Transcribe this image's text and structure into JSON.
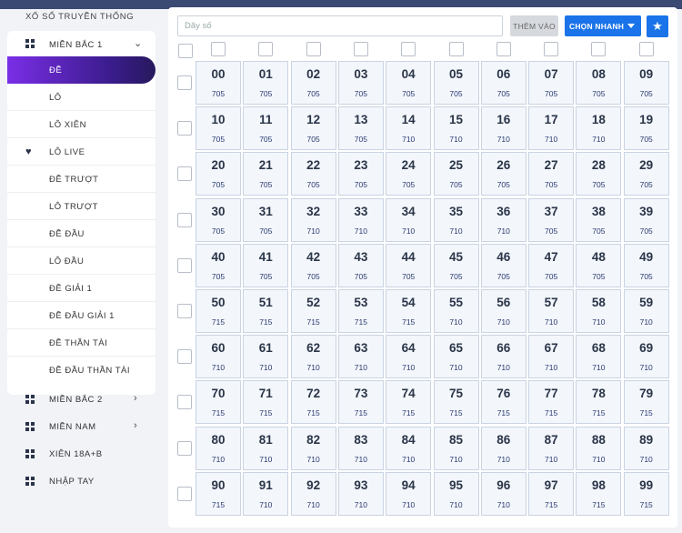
{
  "sidebar": {
    "title": "XỔ SỐ TRUYỀN THỐNG",
    "group": {
      "label": "MIỀN BẮC 1",
      "items": [
        {
          "label": "ĐỀ",
          "active": true
        },
        {
          "label": "LÔ"
        },
        {
          "label": "LÔ XIÊN"
        },
        {
          "label": "LÔ LIVE",
          "icon": "heart-icon"
        },
        {
          "label": "ĐỀ TRƯỢT"
        },
        {
          "label": "LÔ TRƯỢT"
        },
        {
          "label": "ĐỀ ĐẦU"
        },
        {
          "label": "LÔ ĐẦU"
        },
        {
          "label": "ĐỀ GIẢI 1"
        },
        {
          "label": "ĐỀ ĐẦU GIẢI 1"
        },
        {
          "label": "ĐỀ THẦN TÀI"
        },
        {
          "label": "ĐỀ ĐẦU THẦN TÀI"
        }
      ]
    },
    "others": [
      {
        "label": "MIỀN BẮC 2",
        "chevron": true
      },
      {
        "label": "MIỀN NAM",
        "chevron": true
      },
      {
        "label": "XIÊN 18A+B",
        "chevron": false
      },
      {
        "label": "NHẬP TAY",
        "chevron": false
      }
    ]
  },
  "toolbar": {
    "search_placeholder": "Dãy số",
    "add_label": "THÊM VÀO",
    "quick_label": "CHỌN NHANH"
  },
  "numbers": [
    {
      "n": "00",
      "c": "705"
    },
    {
      "n": "01",
      "c": "705"
    },
    {
      "n": "02",
      "c": "705"
    },
    {
      "n": "03",
      "c": "705"
    },
    {
      "n": "04",
      "c": "705"
    },
    {
      "n": "05",
      "c": "705"
    },
    {
      "n": "06",
      "c": "705"
    },
    {
      "n": "07",
      "c": "705"
    },
    {
      "n": "08",
      "c": "705"
    },
    {
      "n": "09",
      "c": "705"
    },
    {
      "n": "10",
      "c": "705"
    },
    {
      "n": "11",
      "c": "705"
    },
    {
      "n": "12",
      "c": "705"
    },
    {
      "n": "13",
      "c": "705"
    },
    {
      "n": "14",
      "c": "710"
    },
    {
      "n": "15",
      "c": "710"
    },
    {
      "n": "16",
      "c": "710"
    },
    {
      "n": "17",
      "c": "710"
    },
    {
      "n": "18",
      "c": "710"
    },
    {
      "n": "19",
      "c": "705"
    },
    {
      "n": "20",
      "c": "705"
    },
    {
      "n": "21",
      "c": "705"
    },
    {
      "n": "22",
      "c": "705"
    },
    {
      "n": "23",
      "c": "705"
    },
    {
      "n": "24",
      "c": "705"
    },
    {
      "n": "25",
      "c": "705"
    },
    {
      "n": "26",
      "c": "705"
    },
    {
      "n": "27",
      "c": "705"
    },
    {
      "n": "28",
      "c": "705"
    },
    {
      "n": "29",
      "c": "705"
    },
    {
      "n": "30",
      "c": "705"
    },
    {
      "n": "31",
      "c": "705"
    },
    {
      "n": "32",
      "c": "710"
    },
    {
      "n": "33",
      "c": "710"
    },
    {
      "n": "34",
      "c": "710"
    },
    {
      "n": "35",
      "c": "710"
    },
    {
      "n": "36",
      "c": "710"
    },
    {
      "n": "37",
      "c": "705"
    },
    {
      "n": "38",
      "c": "705"
    },
    {
      "n": "39",
      "c": "705"
    },
    {
      "n": "40",
      "c": "705"
    },
    {
      "n": "41",
      "c": "705"
    },
    {
      "n": "42",
      "c": "705"
    },
    {
      "n": "43",
      "c": "705"
    },
    {
      "n": "44",
      "c": "705"
    },
    {
      "n": "45",
      "c": "705"
    },
    {
      "n": "46",
      "c": "705"
    },
    {
      "n": "47",
      "c": "705"
    },
    {
      "n": "48",
      "c": "705"
    },
    {
      "n": "49",
      "c": "705"
    },
    {
      "n": "50",
      "c": "715"
    },
    {
      "n": "51",
      "c": "715"
    },
    {
      "n": "52",
      "c": "715"
    },
    {
      "n": "53",
      "c": "715"
    },
    {
      "n": "54",
      "c": "715"
    },
    {
      "n": "55",
      "c": "710"
    },
    {
      "n": "56",
      "c": "710"
    },
    {
      "n": "57",
      "c": "710"
    },
    {
      "n": "58",
      "c": "710"
    },
    {
      "n": "59",
      "c": "710"
    },
    {
      "n": "60",
      "c": "710"
    },
    {
      "n": "61",
      "c": "710"
    },
    {
      "n": "62",
      "c": "710"
    },
    {
      "n": "63",
      "c": "710"
    },
    {
      "n": "64",
      "c": "710"
    },
    {
      "n": "65",
      "c": "710"
    },
    {
      "n": "66",
      "c": "710"
    },
    {
      "n": "67",
      "c": "710"
    },
    {
      "n": "68",
      "c": "710"
    },
    {
      "n": "69",
      "c": "710"
    },
    {
      "n": "70",
      "c": "715"
    },
    {
      "n": "71",
      "c": "715"
    },
    {
      "n": "72",
      "c": "715"
    },
    {
      "n": "73",
      "c": "715"
    },
    {
      "n": "74",
      "c": "715"
    },
    {
      "n": "75",
      "c": "715"
    },
    {
      "n": "76",
      "c": "715"
    },
    {
      "n": "77",
      "c": "715"
    },
    {
      "n": "78",
      "c": "715"
    },
    {
      "n": "79",
      "c": "715"
    },
    {
      "n": "80",
      "c": "710"
    },
    {
      "n": "81",
      "c": "710"
    },
    {
      "n": "82",
      "c": "710"
    },
    {
      "n": "83",
      "c": "710"
    },
    {
      "n": "84",
      "c": "710"
    },
    {
      "n": "85",
      "c": "710"
    },
    {
      "n": "86",
      "c": "710"
    },
    {
      "n": "87",
      "c": "710"
    },
    {
      "n": "88",
      "c": "710"
    },
    {
      "n": "89",
      "c": "710"
    },
    {
      "n": "90",
      "c": "715"
    },
    {
      "n": "91",
      "c": "710"
    },
    {
      "n": "92",
      "c": "710"
    },
    {
      "n": "93",
      "c": "710"
    },
    {
      "n": "94",
      "c": "710"
    },
    {
      "n": "95",
      "c": "710"
    },
    {
      "n": "96",
      "c": "710"
    },
    {
      "n": "97",
      "c": "715"
    },
    {
      "n": "98",
      "c": "715"
    },
    {
      "n": "99",
      "c": "715"
    }
  ]
}
